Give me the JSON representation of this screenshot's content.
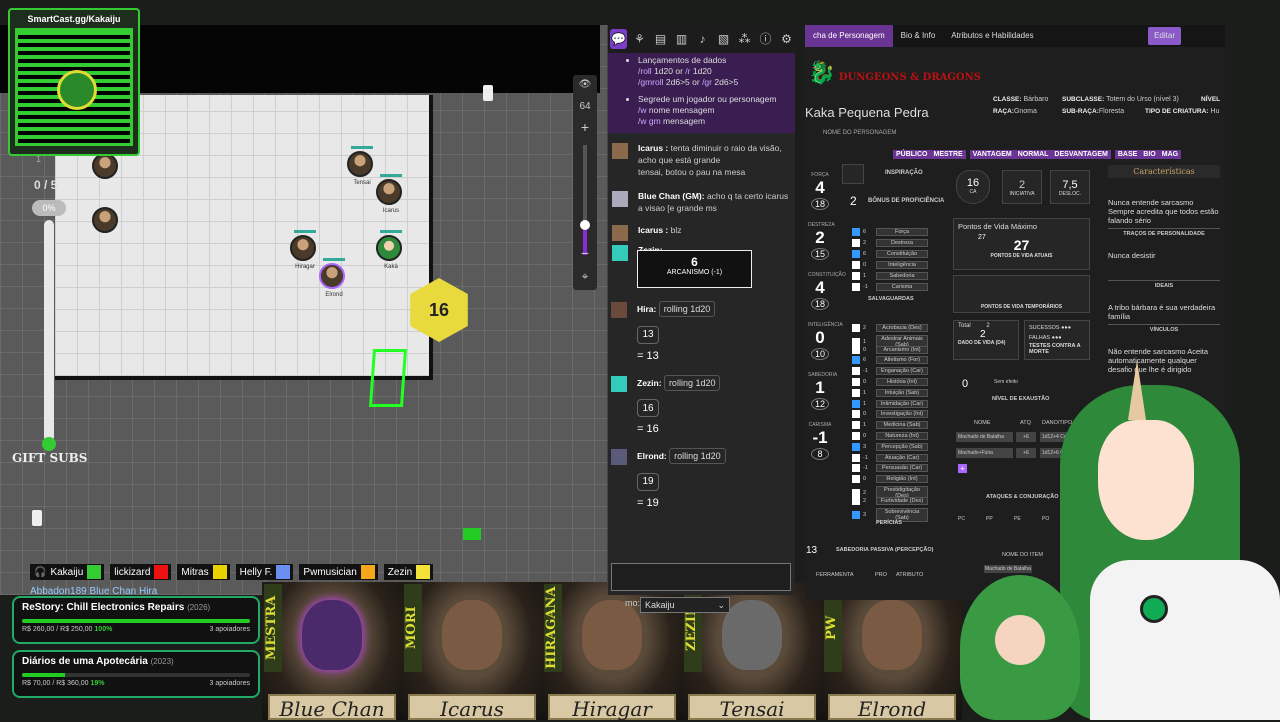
{
  "qr": {
    "url": "SmartCast.gg/Kakaiju"
  },
  "hud": {
    "count": "0 / 5",
    "percent": "0%",
    "gift": "GIFT SUBS",
    "one": "1"
  },
  "map": {
    "zoom_value": "64",
    "dice_value": "16",
    "tokens": [
      {
        "label": "Tensai"
      },
      {
        "label": "Icarus"
      },
      {
        "label": "Hiragar"
      },
      {
        "label": "Kaká"
      },
      {
        "label": "Elrond"
      }
    ]
  },
  "players": [
    {
      "name": "Kakaiju",
      "color": "#3c3"
    },
    {
      "name": "lickizard",
      "color": "#e11"
    },
    {
      "name": "Mitras",
      "color": "#e8d200"
    },
    {
      "name": "Helly F.",
      "color": "#6a8ff0"
    },
    {
      "name": "Pwmusician",
      "color": "#f4a81a"
    },
    {
      "name": "Zezin",
      "color": "#f2e23a"
    }
  ],
  "players_row2": "Abbadon189   Blue Chan   Hira",
  "funding": [
    {
      "name": "ReStory: Chill Electronics Repairs",
      "year": "(2026)",
      "amount": "R$ 260,00 / R$ 250,00",
      "percent": "100%",
      "fill": 100,
      "backers": "3 apoiadores"
    },
    {
      "name": "Diários de uma Apotecária",
      "year": "(2023)",
      "amount": "R$ 70,00 / R$ 360,00",
      "percent": "19%",
      "fill": 19,
      "backers": "3 apoiadores"
    }
  ],
  "portraits": [
    {
      "name": "Blue Chan",
      "tag": "MESTRA"
    },
    {
      "name": "Icarus",
      "tag": "MORI"
    },
    {
      "name": "Hiragar",
      "tag": "HIRAGANA"
    },
    {
      "name": "Tensai",
      "tag": "ZEZIN"
    },
    {
      "name": "Elrond",
      "tag": "PW"
    }
  ],
  "chat": {
    "help_title": "Lançamentos de dados",
    "help_1_cmd": "/roll",
    "help_1": "1d20 or",
    "help_1b_cmd": "/r",
    "help_1b": "1d20",
    "help_2_cmd": "/gmroll",
    "help_2": "2d6>5 or",
    "help_2b_cmd": "/gr",
    "help_2b": "2d6>5",
    "help_3": "Segrede um jogador ou personagem",
    "help_3_cmd": "/w",
    "help_3b": "nome mensagem",
    "help_4_cmd": "/w gm",
    "help_4b": "mensagem",
    "m1_name": "Icarus :",
    "m1_text": "tenta diminuir o raio da visão, acho que está grande",
    "m1_text2": "tensai, botou o pau na mesa",
    "m2_name": "Blue Chan (GM):",
    "m2_text": "acho q ta certo icarus",
    "m2_text2": "a visao [e grande ms",
    "m3_name": "Icarus :",
    "m3_text": "blz",
    "m4_name": "Zezin:",
    "spell_value": "6",
    "spell_label": "ARCANISMO (-1)",
    "m5_name": "Hira:",
    "m5_roll": "rolling 1d20",
    "m5_res": "13",
    "m5_eq": "= 13",
    "m6_name": "Zezin:",
    "m6_roll": "rolling 1d20",
    "m6_res": "16",
    "m6_eq": "= 16",
    "m7_name": "Elrond:",
    "m7_roll": "rolling 1d20",
    "m7_res": "19",
    "m7_eq": "= 19",
    "as_label": "mo:",
    "as_value": "Kakaiju"
  },
  "sheet": {
    "tabs": [
      "cha de Personagem",
      "Bio & Info",
      "Atributos e Habilidades"
    ],
    "edit": "Editar",
    "logo": "DUNGEONS & DRAGONS",
    "char_name": "Kaka Pequena Pedra",
    "char_name_label": "NOME DO PERSONAGEM",
    "class_label": "CLASSE:",
    "class_value": "Bárbaro",
    "subclass_label": "SUBCLASSE:",
    "subclass_value": "Totem do Urso (nível 3)",
    "level_label": "NÍVEL",
    "race_label": "RAÇA:",
    "race_value": "Gnoma",
    "subrace_label": "SUB-RAÇA:",
    "subrace_value": "Floresta",
    "creature_label": "TIPO DE CRIATURA:",
    "creature_value": "Hu",
    "mods": [
      "PÚBLICO",
      "MESTRE",
      "VANTAGEM",
      "NORMAL",
      "DESVANTAGEM",
      "BASE",
      "BIO",
      "MAG"
    ],
    "inspiration": "INSPIRAÇÃO",
    "prof_value": "2",
    "prof_label": "BÔNUS DE PROFICIÊNCIA",
    "abilities": [
      {
        "label": "FORÇA",
        "value": "4",
        "score": "18"
      },
      {
        "label": "DESTREZA",
        "value": "2",
        "score": "15"
      },
      {
        "label": "CONSTITUIÇÃO",
        "value": "4",
        "score": "18"
      },
      {
        "label": "INTELIGÊNCIA",
        "value": "0",
        "score": "10"
      },
      {
        "label": "SABEDORIA",
        "value": "1",
        "score": "12"
      },
      {
        "label": "CARISMA",
        "value": "-1",
        "score": "8"
      }
    ],
    "saves": [
      {
        "v": "6",
        "n": "Força",
        "c": true
      },
      {
        "v": "2",
        "n": "Destreza",
        "c": false
      },
      {
        "v": "6",
        "n": "Constituição",
        "c": true
      },
      {
        "v": "0",
        "n": "Inteligência",
        "c": false
      },
      {
        "v": "1",
        "n": "Sabedoria",
        "c": false
      },
      {
        "v": "-1",
        "n": "Carisma",
        "c": false
      }
    ],
    "saves_label": "SALVAGUARDAS",
    "skills": [
      {
        "v": "2",
        "n": "Acrobacia (Des)",
        "c": false
      },
      {
        "v": "1",
        "n": "Adestrar Animais (Sab)",
        "c": false
      },
      {
        "v": "0",
        "n": "Arcanismo (Int)",
        "c": false
      },
      {
        "v": "6",
        "n": "Atletismo (For)",
        "c": true
      },
      {
        "v": "-1",
        "n": "Enganação (Car)",
        "c": false
      },
      {
        "v": "0",
        "n": "História (Int)",
        "c": false
      },
      {
        "v": "1",
        "n": "Intuição (Sab)",
        "c": false
      },
      {
        "v": "1",
        "n": "Intimidação (Car)",
        "c": true
      },
      {
        "v": "0",
        "n": "Investigação (Int)",
        "c": false
      },
      {
        "v": "1",
        "n": "Medicina (Sab)",
        "c": false
      },
      {
        "v": "0",
        "n": "Natureza (Int)",
        "c": false
      },
      {
        "v": "3",
        "n": "Percepção (Sab)",
        "c": true
      },
      {
        "v": "-1",
        "n": "Atuação (Car)",
        "c": false
      },
      {
        "v": "-1",
        "n": "Persuasão (Car)",
        "c": false
      },
      {
        "v": "0",
        "n": "Religião (Int)",
        "c": false
      },
      {
        "v": "2",
        "n": "Prestidigitação (Des)",
        "c": false
      },
      {
        "v": "2",
        "n": "Furtividade (Des)",
        "c": false
      },
      {
        "v": "3",
        "n": "Sobrevivência (Sab)",
        "c": true
      }
    ],
    "skills_label": "PERÍCIAS",
    "passive_value": "13",
    "passive_label": "SABEDORIA PASSIVA (PERCEPÇÃO)",
    "ca_value": "16",
    "ca_label": "CA",
    "init_value": "2",
    "init_label": "INICIATIVA",
    "speed_value": "7,5",
    "speed_label": "DESLOC.",
    "hp_max_label": "Pontos de Vida Máximo",
    "hp_max": "27",
    "hp_current": "27",
    "hp_current_label": "PONTOS DE VIDA ATUAIS",
    "hp_temp_label": "PONTOS DE VIDA TEMPORÁRIOS",
    "hd_total_label": "Total",
    "hd_total": "2",
    "hd_value": "2",
    "hd_die": "D4",
    "hd_label": "DADO DE VIDA",
    "success_label": "SUCESSOS",
    "fail_label": "FALHAS",
    "death_label": "TESTES CONTRA A MORTE",
    "exhaust_value": "0",
    "exhaust_note": "Sem efeito",
    "exhaust_label": "NÍVEL DE EXAUSTÃO",
    "atk_head": [
      "NOME",
      "ATQ",
      "DANO/TIPO"
    ],
    "attacks": [
      {
        "n": "Machado de Batalha",
        "a": "+6",
        "d": "1d12+4 Corte"
      },
      {
        "n": "Machado+Fúria",
        "a": "+6",
        "d": "1d12+6 Co"
      }
    ],
    "atk_label": "ATAQUES & CONJURAÇÃO",
    "coins": [
      "PC",
      "PP",
      "PE",
      "PO"
    ],
    "item_head": "NOME DO ITEM",
    "item_1": "Machado de Batalha",
    "tool_label": "FERRAMENTA",
    "pro_label": "PRO",
    "attr_label": "ATRIBUTO",
    "traits_title": "Características",
    "trait_1": "Nunca entende sarcasmo Sempre acredita que todos estão falando sério",
    "trait_1_label": "TRAÇOS DE PERSONALIDADE",
    "ideal": "Nunca desistir",
    "ideal_label": "IDEAIS",
    "bond": "A tribo bárbara é sua verdadeira família",
    "bond_label": "VÍNCULOS",
    "flaw": "Não entende sarcasmo Aceita automaticamente qualquer desafio que lhe é dirigido"
  }
}
